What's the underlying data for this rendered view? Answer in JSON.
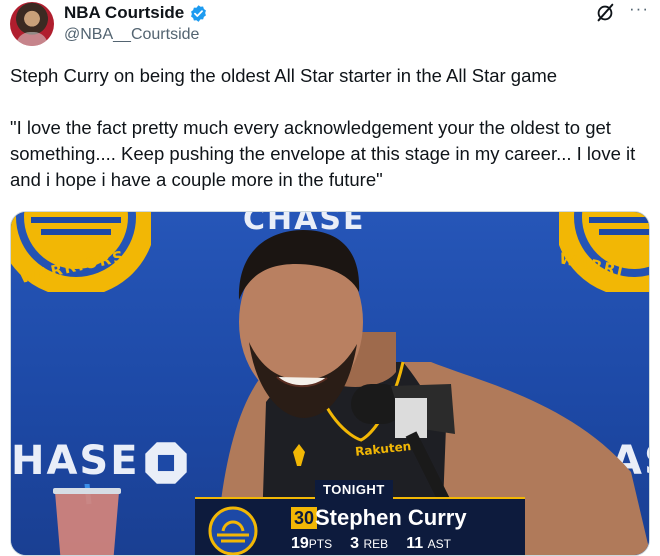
{
  "author": {
    "display_name": "NBA Courtside",
    "handle": "@NBA__Courtside",
    "verified": true,
    "verified_color": "#1d9bf0"
  },
  "header_icons": [
    "grok-icon",
    "more-icon"
  ],
  "more_label": "···",
  "tweet": {
    "paragraph_1": "Steph Curry on being the oldest All Star starter in the All Star game",
    "paragraph_2": "\"I love the fact pretty much every acknowledgement  your the oldest to get something.... Keep pushing the envelope at this stage in my career... I love it and i hope i have a couple more in the future\""
  },
  "media": {
    "backdrop_text_top": "CHASE",
    "backdrop_text_left": "HASE",
    "backdrop_text_right": "ASI",
    "logo_text": "WARRIORS",
    "logo_text_right": "WARRI",
    "jersey_brand": "Rakuten",
    "scoreboard": {
      "tonight_label": "TONIGHT",
      "jersey_number": "30",
      "player_name": "Stephen Curry",
      "points": "19",
      "points_label": "PTS",
      "rebounds": "3",
      "rebounds_label": "REB",
      "assists": "11",
      "assists_label": "AST"
    },
    "colors": {
      "backdrop_blue": "#1d49a6",
      "warriors_gold": "#f2b705",
      "scoreboard_navy": "#0d1b3d"
    }
  }
}
